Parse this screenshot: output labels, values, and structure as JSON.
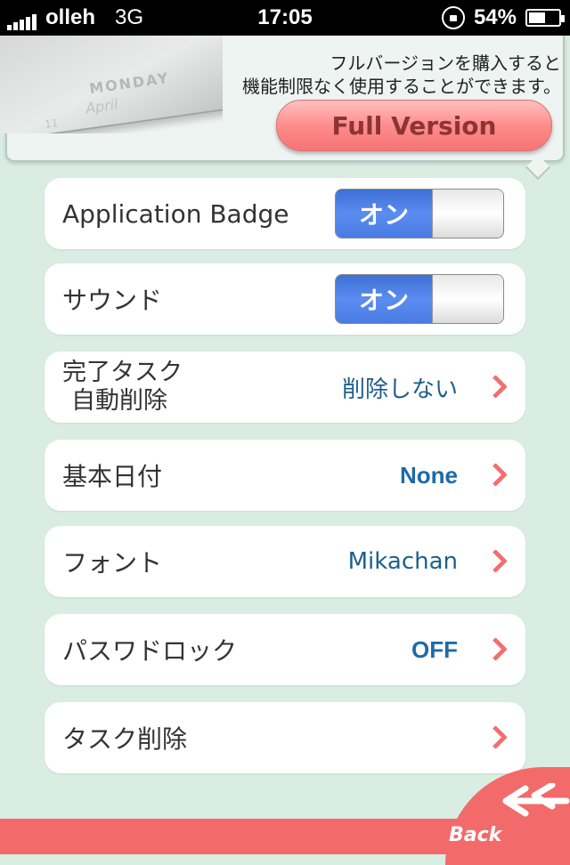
{
  "status_bar": {
    "carrier": "olleh",
    "network": "3G",
    "time": "17:05",
    "battery": "54%"
  },
  "promo": {
    "calendar_day": "MONDAY",
    "calendar_month": "April",
    "calendar_date": "11",
    "message_line1": "フルバージョンを購入すると",
    "message_line2": "機能制限なく使用することができます。",
    "button_label": "Full Version"
  },
  "settings": {
    "app_badge": {
      "label": "Application Badge",
      "toggle": "オン"
    },
    "sound": {
      "label": "サウンド",
      "toggle": "オン"
    },
    "auto_delete": {
      "label_line1": "完了タスク",
      "label_line2": "自動削除",
      "value": "削除しない"
    },
    "base_date": {
      "label": "基本日付",
      "value": "None"
    },
    "font": {
      "label": "フォント",
      "value": "Mikachan"
    },
    "passcode": {
      "label": "パスワドロック",
      "value": "OFF"
    },
    "delete_tasks": {
      "label": "タスク削除"
    }
  },
  "footer": {
    "back_label": "Back"
  },
  "colors": {
    "background": "#d9ede3",
    "accent": "#f26a6a",
    "value_blue": "#1d6ba8",
    "toggle_blue": "#4a7be3"
  }
}
